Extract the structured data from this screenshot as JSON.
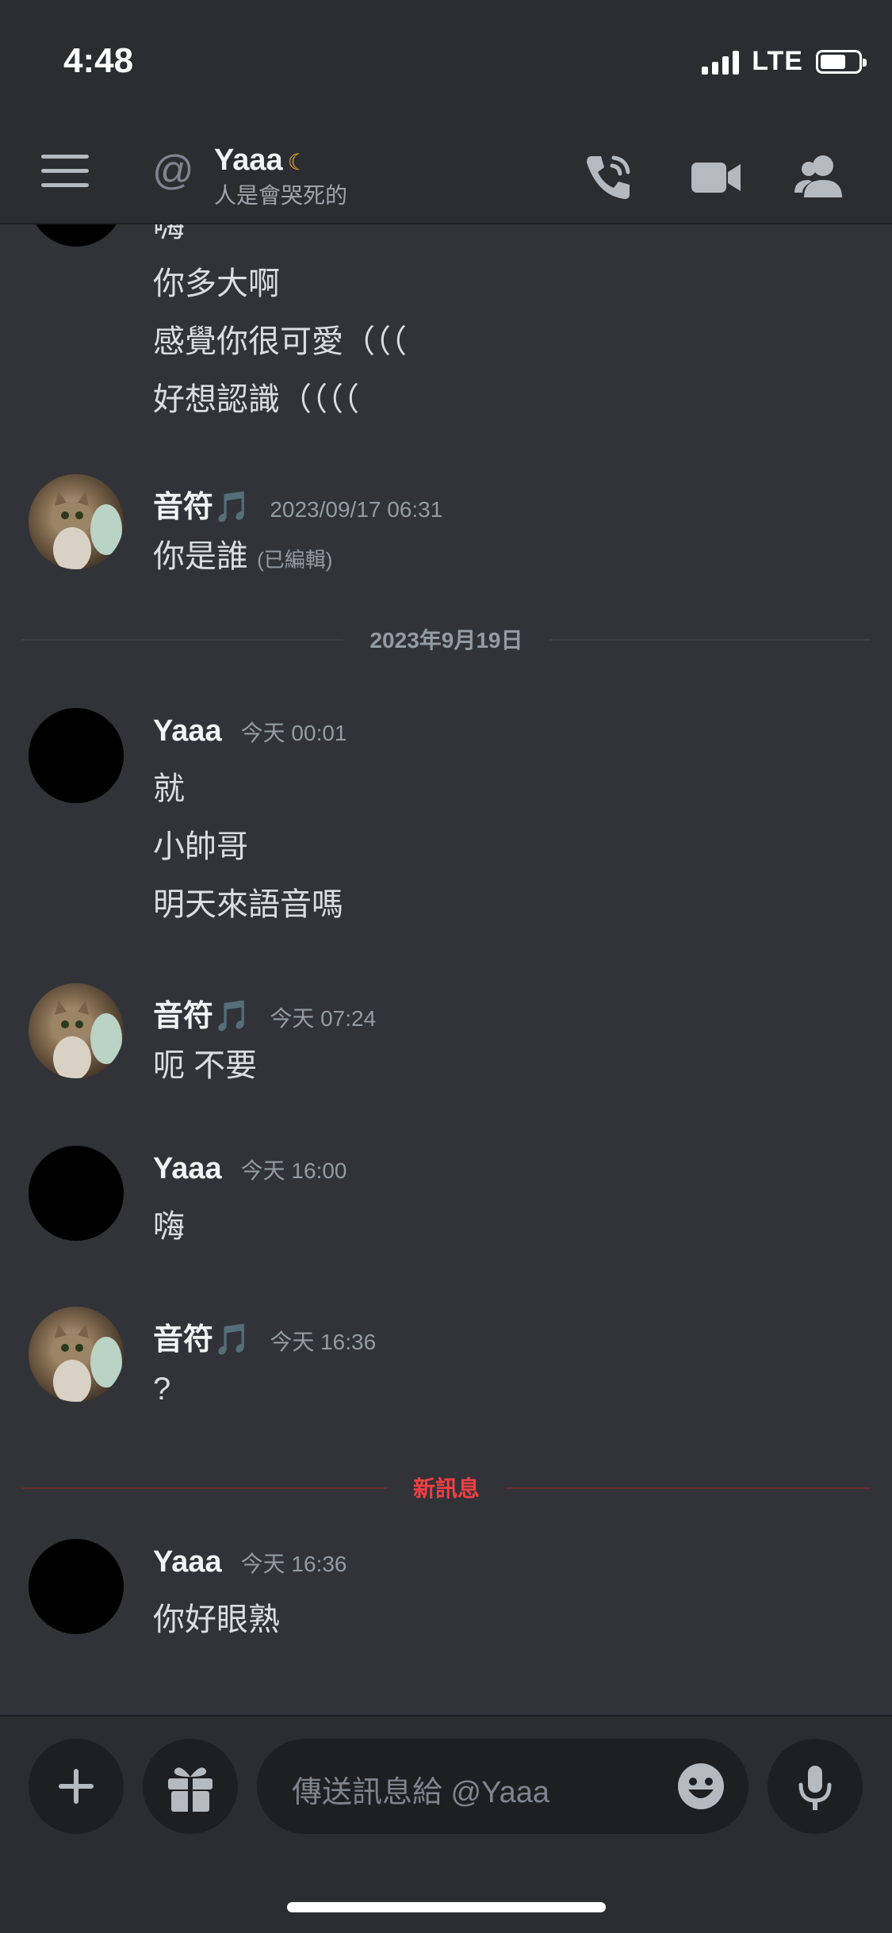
{
  "status": {
    "time": "4:48",
    "network": "LTE"
  },
  "header": {
    "title": "Yaaa",
    "subtitle": "人是會哭死的"
  },
  "messages": {
    "prev": {
      "lines": [
        "嗨",
        "你多大啊",
        "感覺你很可愛（（（",
        "好想認識（（（（"
      ]
    },
    "m1": {
      "author": "音符🎵",
      "time": "2023/09/17 06:31",
      "text": "你是誰",
      "edited": "(已編輯)"
    },
    "date_divider": "2023年9月19日",
    "m2": {
      "author": "Yaaa",
      "time": "今天 00:01",
      "lines": [
        "就",
        "小帥哥",
        "明天來語音嗎"
      ]
    },
    "m3": {
      "author": "音符🎵",
      "time": "今天 07:24",
      "text": "呃 不要"
    },
    "m4": {
      "author": "Yaaa",
      "time": "今天 16:00",
      "text": "嗨"
    },
    "m5": {
      "author": "音符🎵",
      "time": "今天 16:36",
      "text": "?"
    },
    "new_divider": "新訊息",
    "m6": {
      "author": "Yaaa",
      "time": "今天 16:36",
      "text": "你好眼熟"
    }
  },
  "input": {
    "placeholder": "傳送訊息給 @Yaaa"
  },
  "colors": {
    "background": "#313338",
    "panel": "#2b2d31",
    "new_message": "#f23f43",
    "idle_moon": "#f0b232"
  }
}
